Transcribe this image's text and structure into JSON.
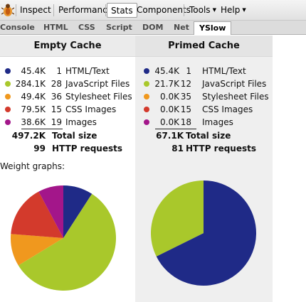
{
  "toolbar": {
    "items": [
      {
        "label": "Inspect"
      },
      {
        "label": "Performance"
      },
      {
        "label": "Stats"
      },
      {
        "label": "Components"
      },
      {
        "label": "Tools"
      },
      {
        "label": "Help"
      }
    ],
    "active": "Stats"
  },
  "tabs": {
    "items": [
      "Console",
      "HTML",
      "CSS",
      "Script",
      "DOM",
      "Net",
      "YSlow"
    ],
    "active": "YSlow"
  },
  "colors": {
    "html": "#1f2a87",
    "js": "#a9c82b",
    "css": "#f0981e",
    "css_images": "#d33a2c",
    "images": "#a3168a"
  },
  "empty": {
    "title": "Empty Cache",
    "rows": [
      {
        "size": "45.4K",
        "count": "1",
        "label": "HTML/Text",
        "color": "#1f2a87"
      },
      {
        "size": "284.1K",
        "count": "28",
        "label": "JavaScript Files",
        "color": "#a9c82b"
      },
      {
        "size": "49.4K",
        "count": "36",
        "label": "Stylesheet Files",
        "color": "#f0981e"
      },
      {
        "size": "79.5K",
        "count": "15",
        "label": "CSS Images",
        "color": "#d33a2c"
      },
      {
        "size": "38.6K",
        "count": "19",
        "label": "Images",
        "color": "#a3168a"
      }
    ],
    "total_size": "497.2K",
    "total_size_label": "Total size",
    "requests": "99",
    "requests_label": "HTTP requests",
    "weight_label": "Weight graphs:",
    "pie_values": [
      45.4,
      284.1,
      49.4,
      79.5,
      38.6
    ]
  },
  "primed": {
    "title": "Primed Cache",
    "rows": [
      {
        "size": "45.4K",
        "count": "1",
        "label": "HTML/Text",
        "color": "#1f2a87"
      },
      {
        "size": "21.7K",
        "count": "12",
        "label": "JavaScript Files",
        "color": "#a9c82b"
      },
      {
        "size": "0.0K",
        "count": "35",
        "label": "Stylesheet Files",
        "color": "#f0981e"
      },
      {
        "size": "0.0K",
        "count": "15",
        "label": "CSS Images",
        "color": "#d33a2c"
      },
      {
        "size": "0.0K",
        "count": "18",
        "label": "Images",
        "color": "#a3168a"
      }
    ],
    "total_size": "67.1K",
    "total_size_label": "Total size",
    "requests": "81",
    "requests_label": "HTTP requests",
    "pie_values": [
      45.4,
      21.7,
      0,
      0,
      0
    ]
  }
}
